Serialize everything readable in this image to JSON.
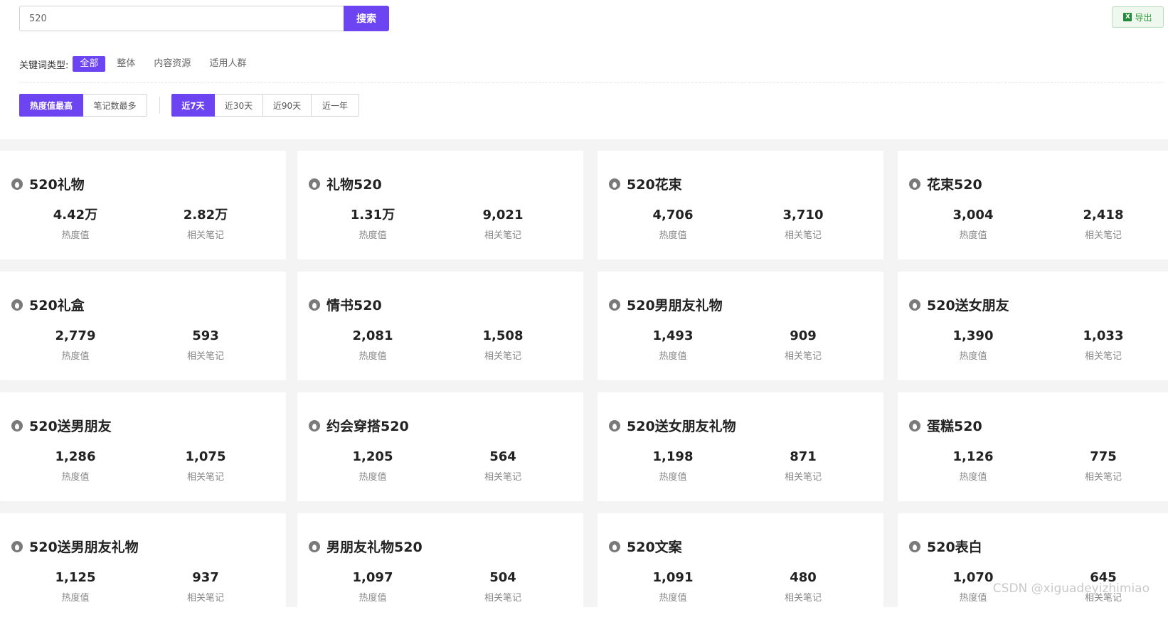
{
  "search": {
    "value": "520",
    "button_label": "搜索"
  },
  "export": {
    "label": "导出",
    "icon": "excel-icon"
  },
  "keyword_type": {
    "label": "关键词类型:",
    "options": [
      "全部",
      "整体",
      "内容资源",
      "适用人群"
    ],
    "active_index": 0
  },
  "sort": {
    "options": [
      "热度值最高",
      "笔记数最多"
    ],
    "active_index": 0
  },
  "period": {
    "options": [
      "近7天",
      "近30天",
      "近90天",
      "近一年"
    ],
    "active_index": 0
  },
  "cards": [
    {
      "title": "520礼物",
      "heat": "4.42万",
      "notes": "2.82万"
    },
    {
      "title": "礼物520",
      "heat": "1.31万",
      "notes": "9,021"
    },
    {
      "title": "520花束",
      "heat": "4,706",
      "notes": "3,710"
    },
    {
      "title": "花束520",
      "heat": "3,004",
      "notes": "2,418"
    },
    {
      "title": "520礼盒",
      "heat": "2,779",
      "notes": "593"
    },
    {
      "title": "情书520",
      "heat": "2,081",
      "notes": "1,508"
    },
    {
      "title": "520男朋友礼物",
      "heat": "1,493",
      "notes": "909"
    },
    {
      "title": "520送女朋友",
      "heat": "1,390",
      "notes": "1,033"
    },
    {
      "title": "520送男朋友",
      "heat": "1,286",
      "notes": "1,075"
    },
    {
      "title": "约会穿搭520",
      "heat": "1,205",
      "notes": "564"
    },
    {
      "title": "520送女朋友礼物",
      "heat": "1,198",
      "notes": "871"
    },
    {
      "title": "蛋糕520",
      "heat": "1,126",
      "notes": "775"
    },
    {
      "title": "520送男朋友礼物",
      "heat": "1,125",
      "notes": "937"
    },
    {
      "title": "男朋友礼物520",
      "heat": "1,097",
      "notes": "504"
    },
    {
      "title": "520文案",
      "heat": "1,091",
      "notes": "480"
    },
    {
      "title": "520表白",
      "heat": "1,070",
      "notes": "645"
    }
  ],
  "labels": {
    "heat": "热度值",
    "notes": "相关笔记"
  },
  "watermark": "CSDN @xiguadeyizhimiao"
}
